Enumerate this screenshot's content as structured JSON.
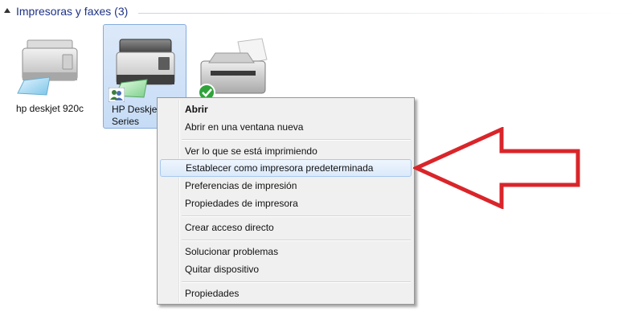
{
  "group": {
    "title": "Impresoras y faxes (3)"
  },
  "devices": [
    {
      "label": "hp deskjet 920c",
      "icon": "printer-icon",
      "selected": false
    },
    {
      "label": "HP Deskjet\nSeries",
      "icon": "multifunction-printer-icon",
      "selected": true,
      "badge": "shared-users-icon"
    },
    {
      "label": "",
      "icon": "default-printer-icon",
      "badge": "default-checkmark-icon"
    }
  ],
  "context_menu": {
    "items": [
      {
        "label": "Abrir",
        "bold": true
      },
      {
        "label": "Abrir en una ventana nueva"
      },
      {
        "label": "Ver lo que se está imprimiendo"
      },
      {
        "label": "Establecer como impresora predeterminada",
        "highlighted": true
      },
      {
        "label": "Preferencias de impresión"
      },
      {
        "label": "Propiedades de impresora"
      },
      {
        "label": "Crear acceso directo"
      },
      {
        "label": "Solucionar problemas"
      },
      {
        "label": "Quitar dispositivo"
      },
      {
        "label": "Propiedades"
      }
    ]
  },
  "colors": {
    "header_text": "#1e3287",
    "selection_bg": "#c6dcf6",
    "selection_border": "#84acdd",
    "highlight_border": "#a8c8ee",
    "annotation_arrow": "#d9252a"
  },
  "annotation": {
    "icon": "red-arrow-pointing-left-icon"
  }
}
